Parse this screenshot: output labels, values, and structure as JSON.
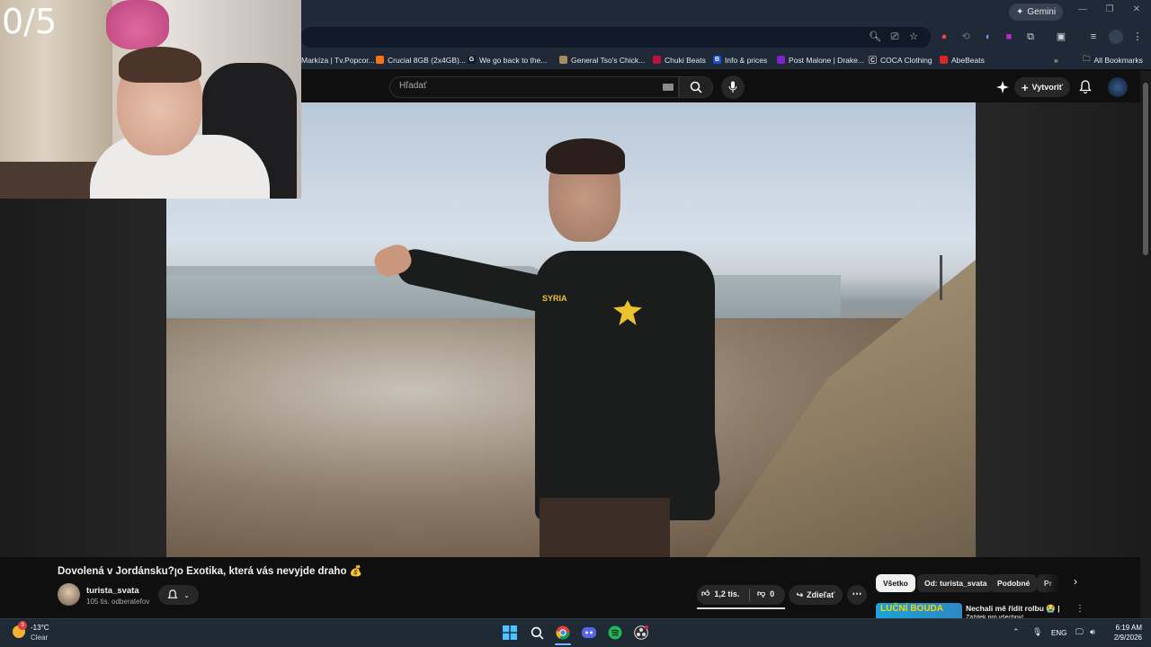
{
  "overlay": {
    "counter": "0/5"
  },
  "browser": {
    "gemini_label": "Gemini",
    "bookmarks": [
      {
        "label": "Markíza | Tv.Popcor...",
        "color": "#4b5563"
      },
      {
        "label": "Crucial 8GB (2x4GB)...",
        "color": "#f97316"
      },
      {
        "label": "We go back to the...",
        "color": "#111827",
        "glyph": "G"
      },
      {
        "label": "General Tso's Chick...",
        "color": "#a78b5b"
      },
      {
        "label": "Chuki Beats",
        "color": "#be123c"
      },
      {
        "label": "Info & prices",
        "color": "#1d4ed8",
        "glyph": "B."
      },
      {
        "label": "Post Malone | Drake...",
        "color": "#7e22ce"
      },
      {
        "label": "COCA Clothing",
        "color": "#111827",
        "glyph": "C"
      },
      {
        "label": "AbeBeats",
        "color": "#dc2626"
      }
    ],
    "all_bookmarks": "All Bookmarks"
  },
  "youtube": {
    "search_placeholder": "Hľadať",
    "create_label": "Vytvoriť"
  },
  "video": {
    "title": "Dovolená v Jordánsku?ꞁo Exotika, která vás nevyjde draho 💰",
    "shirt_text": "SYRIA",
    "channel": "turista_svata",
    "subscribers": "105 tis. odberateľov",
    "likes": "1,2 tis.",
    "dislikes": "0",
    "share_label": "Zdieľať"
  },
  "chips": [
    "Všetko",
    "Od: turista_svata",
    "Podobné",
    "Pr"
  ],
  "recommendation": {
    "thumb_text": "LUČNÍ BOUDA",
    "title": "Nechali mě řídit rolbu 😭 |",
    "subtitle": "Zážitek pro všechny!"
  },
  "taskbar": {
    "temperature": "-13°C",
    "condition": "Clear",
    "weather_badge": "3",
    "language": "ENG",
    "time": "6:19 AM",
    "date": "2/9/2026"
  }
}
